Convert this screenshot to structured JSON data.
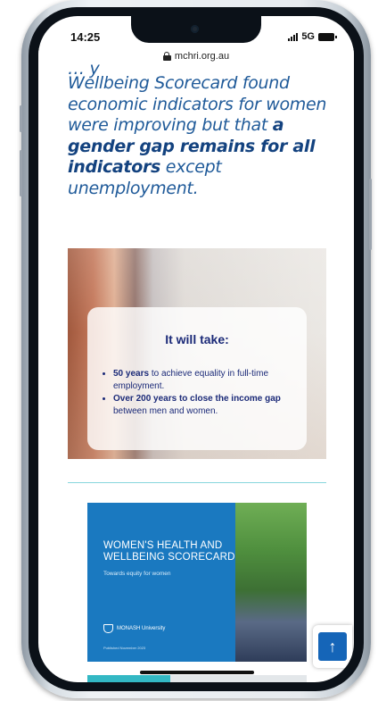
{
  "status_bar": {
    "time": "14:25",
    "network": "5G"
  },
  "browser": {
    "url": "mchri.org.au"
  },
  "intro": {
    "clipped_text": "… y",
    "text_plain": "Wellbeing Scorecard found economic indicators for women were improving but that ",
    "text_bold": "a gender gap remains for all indicators",
    "text_tail": " except unemployment."
  },
  "hero": {
    "title": "It will take:",
    "items": [
      {
        "bold": "50 years",
        "rest": " to achieve equality in full-time employment."
      },
      {
        "bold": "Over 200 years to close the income gap",
        "rest": " between men and women."
      }
    ]
  },
  "report": {
    "title": "WOMEN'S HEALTH AND WELLBEING SCORECARD",
    "subtitle": "Towards equity for women",
    "logo_text": "MONASH University",
    "footer": "Published November 2023"
  },
  "scroll_top_icon": "arrow-up-icon",
  "colors": {
    "intro_text": "#1f5a99",
    "hero_text": "#1b2a78",
    "report_bg": "#1a79c0",
    "accent_teal": "#33b8c4",
    "button_blue": "#1565b8"
  },
  "reading_progress_percent": 38
}
